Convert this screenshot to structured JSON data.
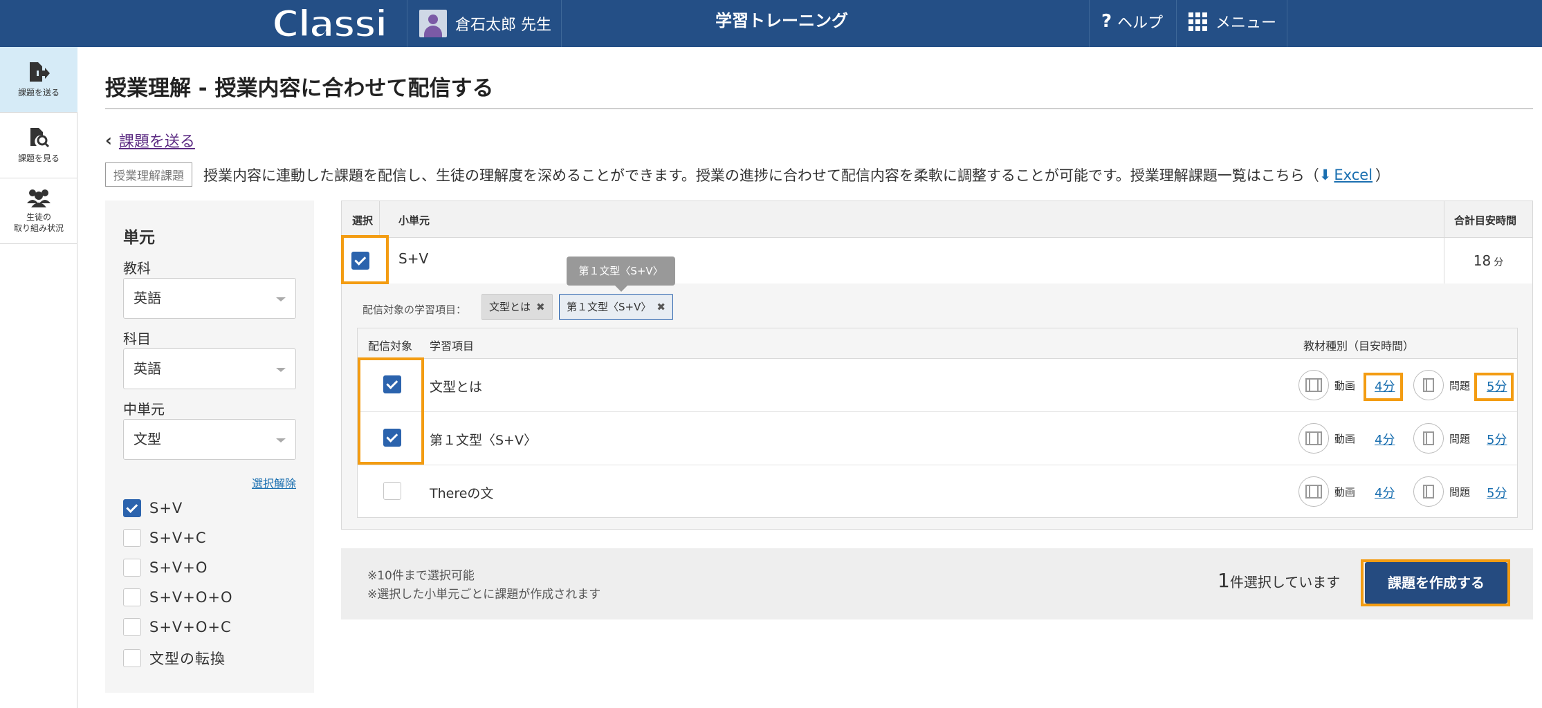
{
  "header": {
    "logo": "Classi",
    "user_name": "倉石太郎 先生",
    "app_title": "学習トレーニング",
    "help_label": "ヘルプ",
    "menu_label": "メニュー"
  },
  "leftnav": [
    {
      "label": "課題を送る",
      "icon": "send-document-icon",
      "active": true
    },
    {
      "label": "課題を見る",
      "icon": "search-document-icon",
      "active": false
    },
    {
      "label_1": "生徒の",
      "label_2": "取り組み状況",
      "icon": "students-icon",
      "active": false
    }
  ],
  "page": {
    "title": "授業理解 - 授業内容に合わせて配信する",
    "back_label": "課題を送る",
    "tag": "授業理解課題",
    "description": "授業内容に連動した課題を配信し、生徒の理解度を深めることができます。授業の進捗に合わせて配信内容を柔軟に調整することが可能です。授業理解課題一覧はこちら（",
    "excel_label": "Excel",
    "description_end": "）"
  },
  "filter": {
    "heading": "単元",
    "subject_label": "教科",
    "subject_value": "英語",
    "course_label": "科目",
    "course_value": "英語",
    "unit_label": "中単元",
    "unit_value": "文型",
    "clear_label": "選択解除",
    "options": [
      {
        "label": "S+V",
        "checked": true
      },
      {
        "label": "S+V+C",
        "checked": false
      },
      {
        "label": "S+V+O",
        "checked": false
      },
      {
        "label": "S+V+O+O",
        "checked": false
      },
      {
        "label": "S+V+O+C",
        "checked": false
      },
      {
        "label": "文型の転換",
        "checked": false
      }
    ]
  },
  "table": {
    "col_select": "選択",
    "col_subunit": "小単元",
    "col_total": "合計目安時間",
    "row": {
      "name": "S+V",
      "time": "18",
      "time_unit": "分",
      "checked": true
    },
    "target_label": "配信対象の学習項目：",
    "chips": [
      "文型とは",
      "第１文型〈S+V〉"
    ],
    "tooltip": "第１文型〈S+V〉",
    "inner_headers": {
      "target": "配信対象",
      "item": "学習項目",
      "material": "教材種別（目安時間）"
    },
    "items": [
      {
        "name": "文型とは",
        "checked": true,
        "video_label": "動画",
        "video_time": "4分",
        "question_label": "問題",
        "question_time": "5分"
      },
      {
        "name": "第１文型〈S+V〉",
        "checked": true,
        "video_label": "動画",
        "video_time": "4分",
        "question_label": "問題",
        "question_time": "5分"
      },
      {
        "name": "Thereの文",
        "checked": false,
        "video_label": "動画",
        "video_time": "4分",
        "question_label": "問題",
        "question_time": "5分"
      }
    ]
  },
  "footer": {
    "note_1": "※10件まで選択可能",
    "note_2": "※選択した小単元ごとに課題が作成されます",
    "count": "1",
    "count_suffix": "件選択しています",
    "create_label": "課題を作成する"
  },
  "colors": {
    "header_bg": "#244f86",
    "primary": "#2b63ad",
    "highlight": "#f39c12",
    "link": "#1a6fb0"
  }
}
